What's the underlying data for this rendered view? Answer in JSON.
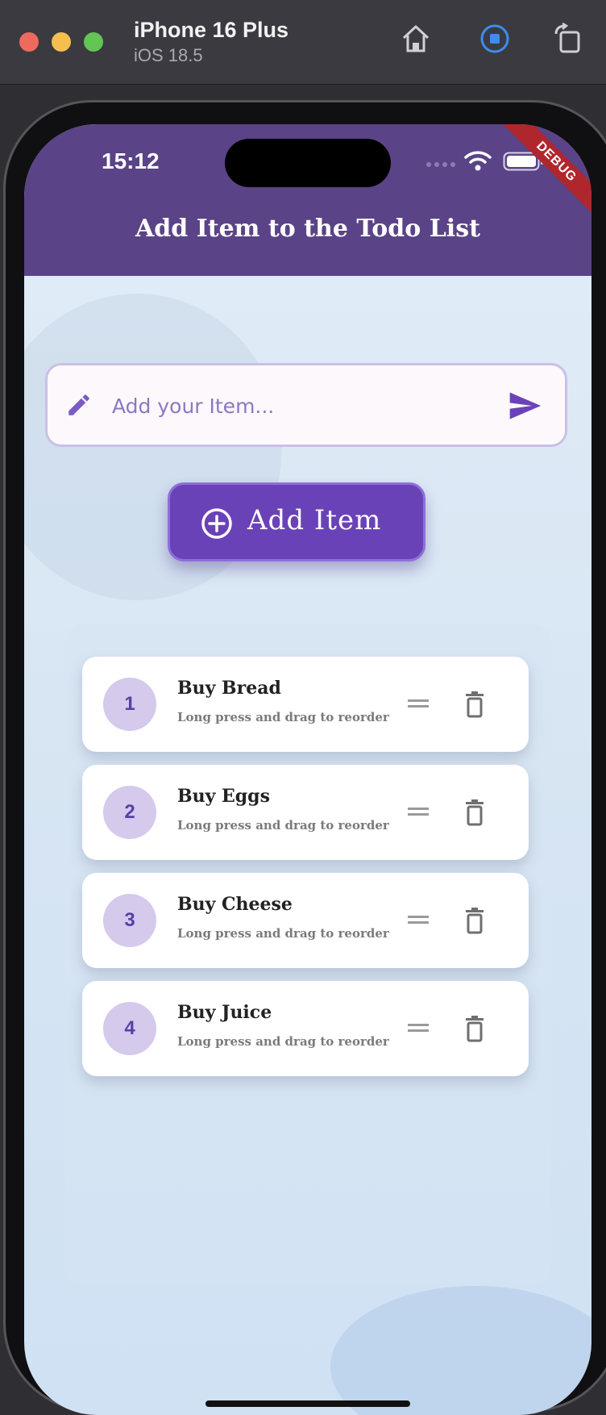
{
  "simulator": {
    "device_name": "iPhone 16 Plus",
    "os_version": "iOS 18.5",
    "icons": [
      "home-icon",
      "stop-recording-icon",
      "rotate-icon"
    ]
  },
  "status_bar": {
    "time": "15:12"
  },
  "debug_banner": "DEBUG",
  "app_bar": {
    "title": "Add Item to the Todo List"
  },
  "input": {
    "placeholder": "Add your Item...",
    "value": ""
  },
  "add_button": {
    "label": "Add Item"
  },
  "todos": [
    {
      "number": "1",
      "title": "Buy Bread",
      "subtitle": "Long press and drag to reorder"
    },
    {
      "number": "2",
      "title": "Buy Eggs",
      "subtitle": "Long press and drag to reorder"
    },
    {
      "number": "3",
      "title": "Buy Cheese",
      "subtitle": "Long press and drag to reorder"
    },
    {
      "number": "4",
      "title": "Buy Juice",
      "subtitle": "Long press and drag to reorder"
    }
  ],
  "colors": {
    "app_bar": "#5a4387",
    "accent": "#6a42b8",
    "number_badge": "#d5c9ec",
    "debug": "#b0262d"
  }
}
